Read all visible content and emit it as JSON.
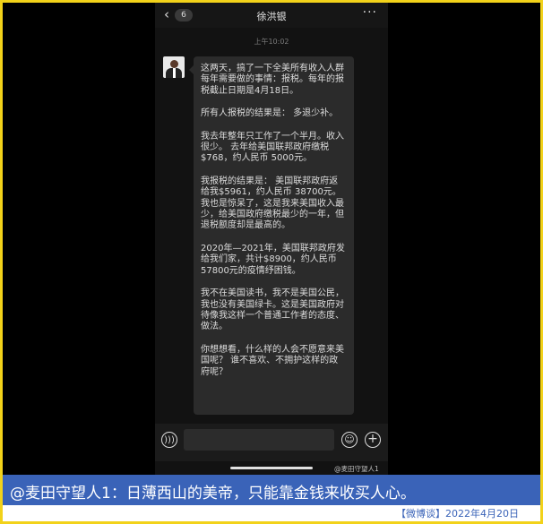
{
  "header": {
    "back_icon": "‹",
    "unread_count": "6",
    "contact_name": "徐洪银",
    "more_icon": "···"
  },
  "chat": {
    "timestamp": "上午10:02",
    "message_paragraphs": [
      "这两天，搞了一下全美所有收入人群每年需要做的事情：报税。每年的报税截止日期是4月18日。",
      "所有人报税的结果是： 多退少补。",
      "我去年整年只工作了一个半月。收入很少。 去年给美国联邦政府缴税$768，约人民币 5000元。",
      "我报税的结果是： 美国联邦政府返给我$5961，约人民币 38700元。\n我也是惊呆了，这是我来美国收入最少，给美国政府缴税最少的一年，但退税额度却是最高的。",
      "2020年—2021年，美国联邦政府发给我们家，共计$8900，约人民币 57800元的疫情纾困钱。",
      "我不在美国读书，我不是美国公民，我也没有美国绿卡。这是美国政府对待像我这样一个普通工作者的态度、做法。",
      "你想想看，什么样的人会不愿意来美国呢？ 谁不喜欢、不拥护这样的政府呢？"
    ]
  },
  "input_bar": {
    "voice_icon": "voice-icon",
    "emoji_icon": "emoji-icon",
    "plus_icon": "plus-icon"
  },
  "watermark": "@麦田守望人1",
  "caption": "@麦田守望人1：日薄西山的美帝，只能靠金钱来收买人心。",
  "footer": "【微博谈】2022年4月20日",
  "colors": {
    "border": "#f2d21a",
    "caption_bg": "#3a63b8",
    "bubble_bg": "#2b2b2b"
  }
}
